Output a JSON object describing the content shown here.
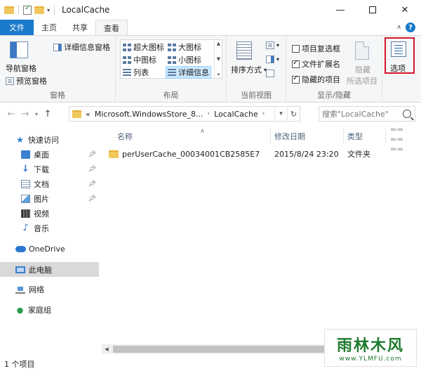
{
  "window": {
    "title": "LocalCache",
    "minimize_glyph": "—",
    "close_glyph": "✕"
  },
  "tabs": [
    {
      "label": "文件"
    },
    {
      "label": "主页"
    },
    {
      "label": "共享"
    },
    {
      "label": "查看"
    }
  ],
  "ribbon": {
    "panes": {
      "label": "窗格",
      "navigation_pane": "导航窗格",
      "preview_pane": "预览窗格",
      "details_pane": "详细信息窗格"
    },
    "layout": {
      "label": "布局",
      "extra_large_icons": "超大图标",
      "large_icons": "大图标",
      "medium_icons": "中图标",
      "small_icons": "小图标",
      "list": "列表",
      "details": "详细信息"
    },
    "current_view": {
      "label": "当前视图",
      "sort_by": "排序方式"
    },
    "show_hide": {
      "label": "显示/隐藏",
      "item_checkboxes": "项目复选框",
      "file_extensions": "文件扩展名",
      "hidden_items": "隐藏的项目",
      "hide_line1": "隐藏",
      "hide_line2": "所选项目"
    },
    "options": {
      "label": "选项"
    }
  },
  "address": {
    "overflow": "«",
    "crumbs": [
      "Microsoft.WindowsStore_8...",
      "LocalCache"
    ],
    "search_placeholder": "搜索\"LocalCache\""
  },
  "navpane": {
    "quick_access": "快速访问",
    "desktop": "桌面",
    "downloads": "下载",
    "documents": "文档",
    "pictures": "图片",
    "videos": "视频",
    "music": "音乐",
    "onedrive": "OneDrive",
    "this_pc": "此电脑",
    "network": "网络",
    "homegroup": "家庭组"
  },
  "columns": {
    "name": "名称",
    "date_modified": "修改日期",
    "type": "类型"
  },
  "files": [
    {
      "name": "perUserCache_00034001CB2585E7",
      "date": "2015/8/24 23:20",
      "type": "文件夹"
    }
  ],
  "status": {
    "item_count": "1 个项目"
  },
  "watermark": {
    "main": "雨林木风",
    "sub": "www.YLMFU.com"
  }
}
